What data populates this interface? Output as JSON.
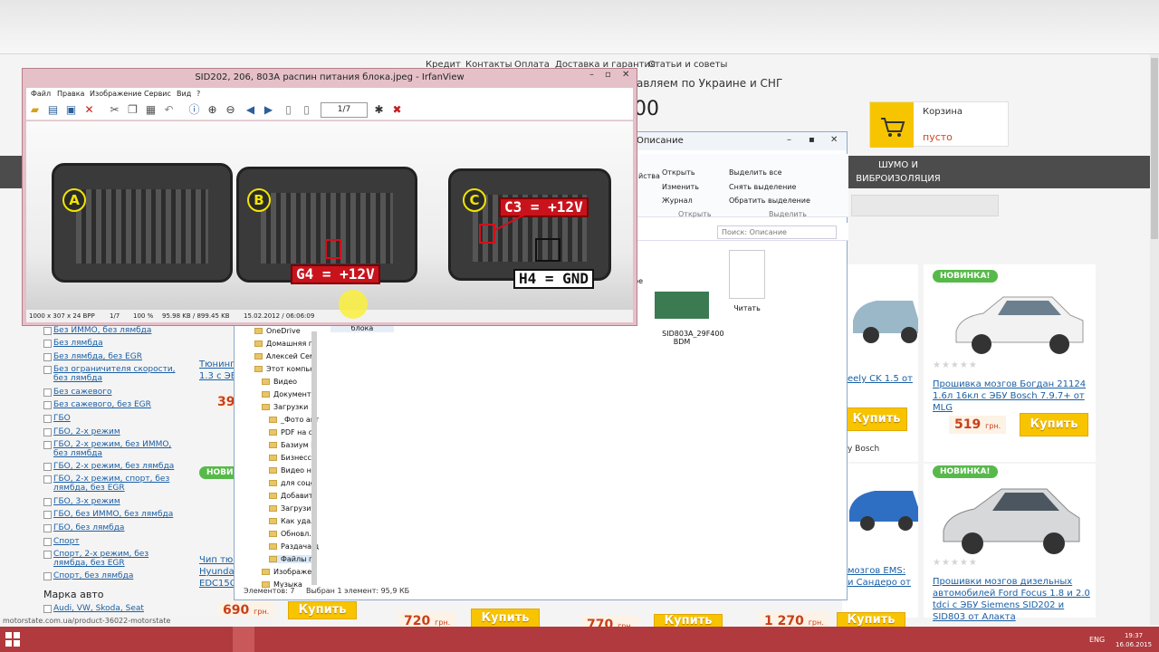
{
  "site": {
    "nav": [
      "Кредит",
      "Контакты",
      "Оплата",
      "Доставка и гарантия",
      "Статьи и советы"
    ],
    "shipping": "авляем по Украине и СНГ",
    "phone_fragment": "00",
    "cart": {
      "title": "Корзина",
      "status": "пусто"
    },
    "menu_right": "ШУМО И ВИБРОИЗОЛЯЦИЯ",
    "categories": [
      "Без ИММО, без лямбда",
      "Без лямбда",
      "Без лямбда, без EGR",
      "Без ограничителя скорости,\nбез лямбда",
      "Без сажевого",
      "Без сажевого, без EGR",
      "ГБО",
      "ГБО, 2-х режим",
      "ГБО, 2-х режим, без ИММО,\nбез лямбда",
      "ГБО, 2-х режим, без лямбда",
      "ГБО, 2-х режим, спорт, без\nлямбда, без EGR",
      "ГБО, 3-х режим",
      "ГБО, без ИММО, без лямбда",
      "ГБО, без лямбда",
      "Спорт",
      "Спорт, 2-х режим, без\nлямбда, без EGR",
      "Спорт, без лямбда"
    ],
    "marka_title": "Марка авто",
    "marka_item": "Audi, VW, Skoda, Seat",
    "badge_new": "НОВИНКА!",
    "buy_label": "Купить",
    "currency": "грн.",
    "products": [
      {
        "title": "Прошивка мозгов Богдан 21124 1.6л 16кл с ЭБУ Bosch 7.9.7+ от MLG",
        "price": "519"
      },
      {
        "title": "Прошивки мозгов дизельных автомобилей Ford Focus 1.8 и 2.0 tdci с ЭБУ Siemens SID202 и SID803 от Алакта",
        "price": "1 270"
      }
    ],
    "partials": {
      "tuning": "Тюнинг\n1.3 с ЭБ",
      "tuning_price": "39",
      "chip": "Чип тюн\nHyunda\nEDC15C",
      "chip_price": "690",
      "geely": "eely CK 1.5 от",
      "bosch": "у Bosch",
      "ems": "мозгов EMS:\nи Сандеро от",
      "price_720": "720",
      "price_770": "770"
    },
    "url_tip": "motorstate.com.ua/product-36022-motorstate"
  },
  "explorer": {
    "title": "Описание",
    "ribbon": {
      "open": "Открыть",
      "change": "Изменить",
      "journal": "Журнал",
      "select_all": "Выделить все",
      "select_none": "Снять выделение",
      "invert": "Обратить выделение",
      "group_open": "Открыть",
      "group_select": "Выделить",
      "props": "йства"
    },
    "search_placeholder": "Поиск: Описание",
    "tree": [
      "OneDrive",
      "Домашняя гр",
      "Алексей Сем",
      "Этот компью",
      "Видео",
      "Документ",
      "Загрузки",
      "_Фото авт",
      "PDF на со",
      "Базиум М",
      "Бизнесс /",
      "Видео на",
      "для соцс",
      "Добавит",
      "Загрузит",
      "Как удал",
      "Обновл.",
      "Раздача д",
      "Файлы п",
      "Изображен",
      "Музыка"
    ],
    "files": [
      {
        "name": "SID803A_29F400\nBDM"
      },
      {
        "name": "Читать"
      },
      {
        "name": "ре"
      },
      {
        "name": "блока"
      }
    ],
    "status_count": "Элементов: 7",
    "status_selected": "Выбран 1 элемент: 95,9 КБ"
  },
  "irfanview": {
    "title": "SID202, 206, 803A распин питания блока.jpeg - IrfanView",
    "menu": [
      "Файл",
      "Правка",
      "Изображение",
      "Сервис",
      "Вид",
      "?"
    ],
    "page": "1/7",
    "status": [
      "1000 x 307 x 24 BPP",
      "1/7",
      "100 %",
      "95.98 KB / 899.45 KB",
      "15.02.2012 / 06:06:09"
    ],
    "connectors": [
      "A",
      "B",
      "C"
    ],
    "labels": {
      "c3": "C3 = +12V",
      "g4": "G4 = +12V",
      "h4": "H4 = GND"
    }
  },
  "taskbar": {
    "lang": "ENG",
    "time": "19:37",
    "date": "16.06.2015"
  },
  "colors": {
    "accent_yellow": "#f8c400",
    "taskbar": "#b03a3d",
    "badge_green": "#58b94b",
    "pin_red": "#c9131c"
  }
}
